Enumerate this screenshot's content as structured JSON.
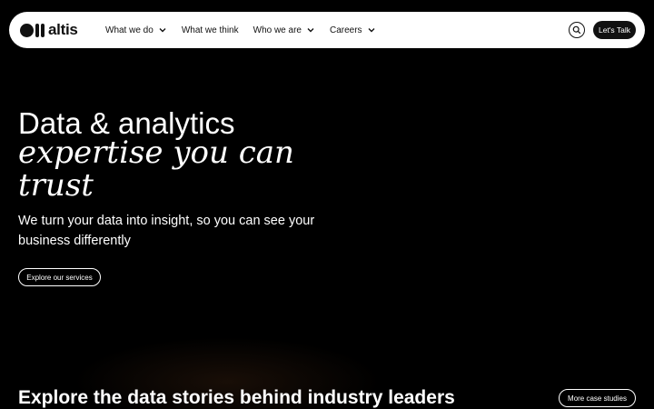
{
  "brand": {
    "name": "altis"
  },
  "nav": {
    "items": [
      {
        "label": "What we do",
        "has_dropdown": true
      },
      {
        "label": "What we think",
        "has_dropdown": false
      },
      {
        "label": "Who we are",
        "has_dropdown": true
      },
      {
        "label": "Careers",
        "has_dropdown": true
      }
    ],
    "search_icon": "search-icon",
    "cta_label": "Let's Talk"
  },
  "hero": {
    "heading_line1": "Data & analytics",
    "heading_serif": "expertise you can trust",
    "subtitle": "We turn your data into insight, so you can see your business differently",
    "button_label": "Explore our services"
  },
  "case_studies": {
    "title": "Explore the data stories behind industry leaders",
    "button_label": "More case studies"
  },
  "colors": {
    "background": "#000000",
    "navbar": "#ffffff",
    "text": "#ffffff",
    "dark": "#111111"
  }
}
